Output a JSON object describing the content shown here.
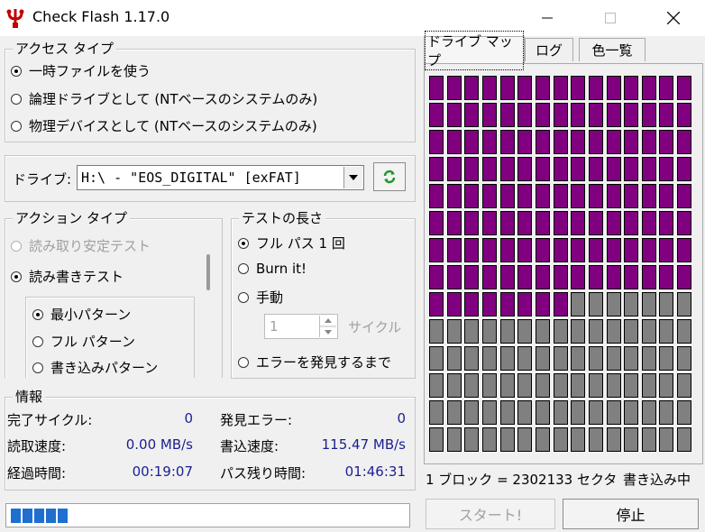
{
  "window": {
    "title": "Check Flash 1.17.0"
  },
  "access": {
    "legend": "アクセス タイプ",
    "options": [
      {
        "label": "一時ファイルを使う",
        "selected": true
      },
      {
        "label": "論理ドライブとして (NTベースのシステムのみ)",
        "selected": false
      },
      {
        "label": "物理デバイスとして (NTベースのシステムのみ)",
        "selected": false
      }
    ]
  },
  "drive": {
    "label": "ドライブ:",
    "value": "H:\\ - \"EOS_DIGITAL\" [exFAT]",
    "refresh_icon": "refresh-icon"
  },
  "action": {
    "legend": "アクション タイプ",
    "options": [
      {
        "label": "読み取り安定テスト",
        "selected": false,
        "disabled": true
      },
      {
        "label": "読み書きテスト",
        "selected": true,
        "disabled": false
      }
    ],
    "patterns": [
      {
        "label": "最小パターン",
        "selected": true
      },
      {
        "label": "フル パターン",
        "selected": false
      },
      {
        "label": "書き込みパターン",
        "selected": false
      }
    ]
  },
  "length": {
    "legend": "テストの長さ",
    "options": [
      {
        "label": "フル パス 1 回",
        "selected": true
      },
      {
        "label": "Burn it!",
        "selected": false
      },
      {
        "label": "手動",
        "selected": false
      }
    ],
    "manual_value": "1",
    "manual_unit": "サイクル",
    "until_error": "エラーを発見するまで"
  },
  "info": {
    "legend": "情報",
    "rows": [
      {
        "l1": "完了サイクル:",
        "v1": "0",
        "l2": "発見エラー:",
        "v2": "0"
      },
      {
        "l1": "読取速度:",
        "v1": "0.00 MB/s",
        "l2": "書込速度:",
        "v2": "115.47 MB/s"
      },
      {
        "l1": "経過時間:",
        "v1": "00:19:07",
        "l2": "パス残り時間:",
        "v2": "01:46:31"
      }
    ]
  },
  "tabs": [
    {
      "label": "ドライブ マップ",
      "active": true
    },
    {
      "label": "ログ",
      "active": false
    },
    {
      "label": "色一覧",
      "active": false
    }
  ],
  "map": {
    "columns": 15,
    "rows": 14,
    "written_blocks": 128,
    "colors": {
      "written": "#800080",
      "empty": "#808080"
    }
  },
  "status": {
    "block_info": "1 ブロック = 2302133 セクタ",
    "state": "書き込み中"
  },
  "progress": {
    "segments": 5
  },
  "buttons": {
    "start": "スタート!",
    "stop": "停止"
  }
}
